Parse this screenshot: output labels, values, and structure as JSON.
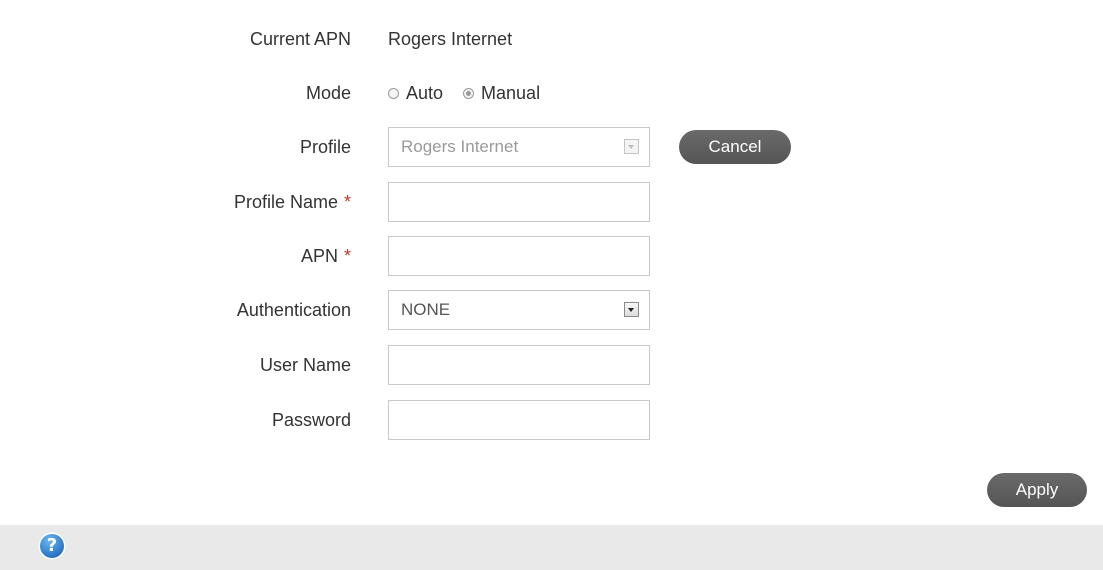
{
  "current_apn": {
    "label": "Current APN",
    "value": "Rogers Internet"
  },
  "mode": {
    "label": "Mode",
    "options": [
      {
        "label": "Auto",
        "selected": false
      },
      {
        "label": "Manual",
        "selected": true
      }
    ]
  },
  "profile": {
    "label": "Profile",
    "selected": "Rogers Internet",
    "disabled": true,
    "cancel_label": "Cancel"
  },
  "profile_name": {
    "label": "Profile Name",
    "required_mark": "*",
    "value": ""
  },
  "apn": {
    "label": "APN",
    "required_mark": "*",
    "value": ""
  },
  "authentication": {
    "label": "Authentication",
    "selected": "NONE"
  },
  "user_name": {
    "label": "User Name",
    "value": ""
  },
  "password": {
    "label": "Password",
    "value": ""
  },
  "apply_label": "Apply",
  "help": {
    "icon": "help-icon",
    "glyph": "?"
  },
  "colors": {
    "button": "#5f5f5f",
    "required": "#c0392b",
    "help_bar": "#e9e9e9",
    "help_icon": "#2f83d6"
  }
}
